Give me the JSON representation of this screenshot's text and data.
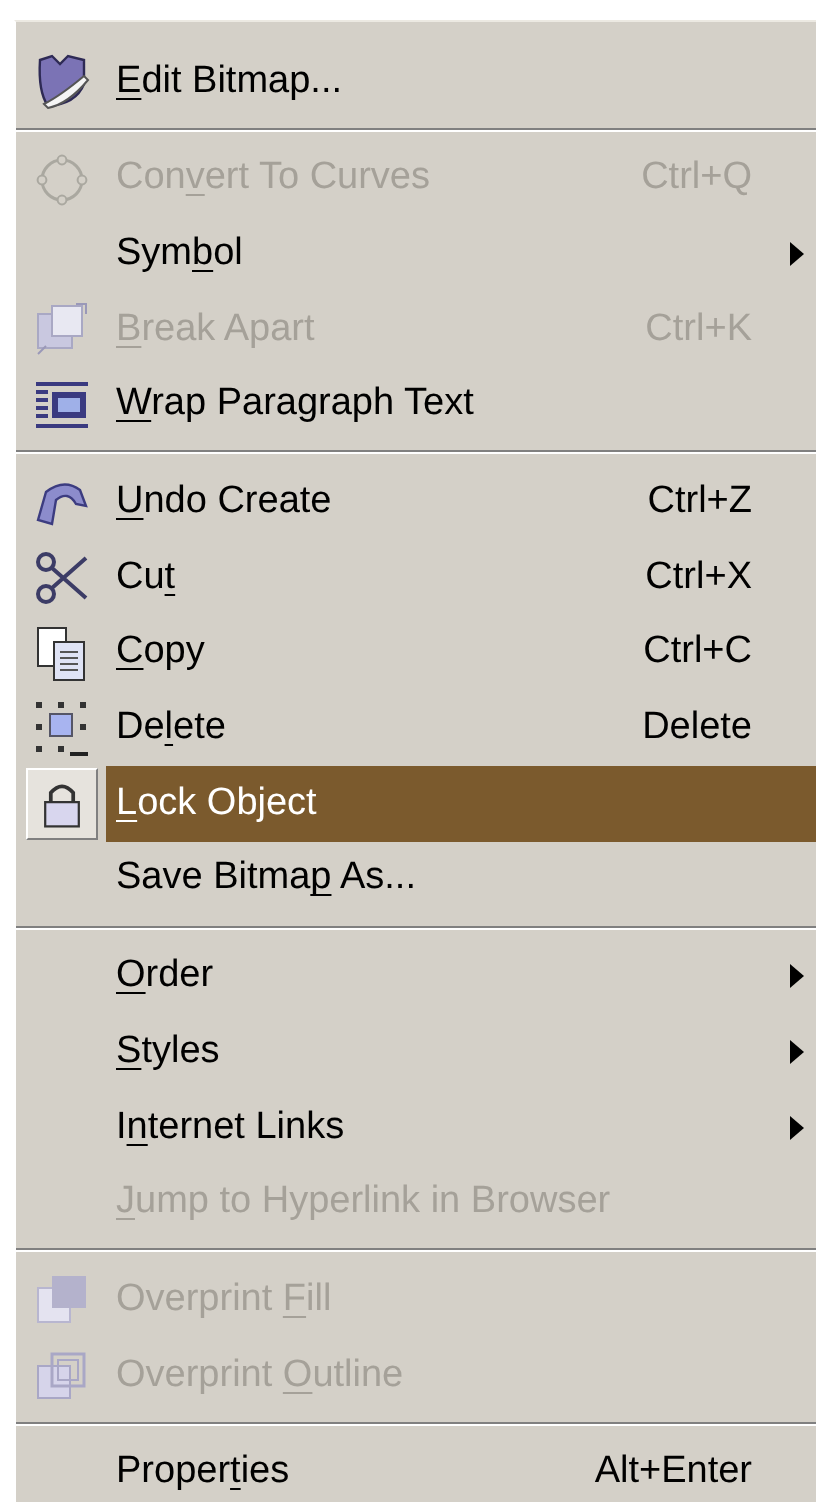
{
  "menu": {
    "sections": [
      {
        "items": [
          {
            "label": {
              "key": "E",
              "after": "dit Bitmap..."
            },
            "disabled": false,
            "selected": false,
            "submenu": false
          }
        ]
      },
      {
        "items": [
          {
            "label": {
              "before": "Con",
              "key": "v",
              "after": "ert To Curves"
            },
            "shortcut": "Ctrl+Q",
            "disabled": true,
            "selected": false,
            "submenu": false
          },
          {
            "label": {
              "before": "Sym",
              "key": "b",
              "after": "ol"
            },
            "disabled": false,
            "selected": false,
            "submenu": true
          },
          {
            "label": {
              "key": "B",
              "after": "reak Apart"
            },
            "shortcut": "Ctrl+K",
            "disabled": true,
            "selected": false,
            "submenu": false
          },
          {
            "label": {
              "key": "W",
              "after": "rap Paragraph Text"
            },
            "disabled": false,
            "selected": false,
            "submenu": false
          }
        ]
      },
      {
        "items": [
          {
            "label": {
              "key": "U",
              "after": "ndo Create"
            },
            "shortcut": "Ctrl+Z",
            "disabled": false,
            "selected": false,
            "submenu": false
          },
          {
            "label": {
              "before": "Cu",
              "key": "t"
            },
            "shortcut": "Ctrl+X",
            "disabled": false,
            "selected": false,
            "submenu": false
          },
          {
            "label": {
              "key": "C",
              "after": "opy"
            },
            "shortcut": "Ctrl+C",
            "disabled": false,
            "selected": false,
            "submenu": false
          },
          {
            "label": {
              "before": "De",
              "key": "l",
              "after": "ete"
            },
            "shortcut": "Delete",
            "disabled": false,
            "selected": false,
            "submenu": false
          },
          {
            "label": {
              "key": "L",
              "after": "ock Object"
            },
            "disabled": false,
            "selected": true,
            "submenu": false
          },
          {
            "label": {
              "before": "Save Bitma",
              "key": "p",
              "after": " As..."
            },
            "disabled": false,
            "selected": false,
            "submenu": false
          }
        ]
      },
      {
        "items": [
          {
            "label": {
              "key": "O",
              "after": "rder"
            },
            "disabled": false,
            "selected": false,
            "submenu": true
          },
          {
            "label": {
              "key": "S",
              "after": "tyles"
            },
            "disabled": false,
            "selected": false,
            "submenu": true
          },
          {
            "label": {
              "before": "I",
              "key": "n",
              "after": "ternet Links"
            },
            "disabled": false,
            "selected": false,
            "submenu": true
          },
          {
            "label": {
              "key": "J",
              "after": "ump to Hyperlink in Browser"
            },
            "disabled": true,
            "selected": false,
            "submenu": false
          }
        ]
      },
      {
        "items": [
          {
            "label": {
              "before": "Overprint ",
              "key": "F",
              "after": "ill"
            },
            "disabled": true,
            "selected": false,
            "submenu": false
          },
          {
            "label": {
              "before": "Overprint ",
              "key": "O",
              "after": "utline"
            },
            "disabled": true,
            "selected": false,
            "submenu": false
          }
        ]
      },
      {
        "items": [
          {
            "label": {
              "before": "Proper",
              "key": "t",
              "after": "ies"
            },
            "shortcut": "Alt+Enter",
            "disabled": false,
            "selected": false,
            "submenu": false
          }
        ]
      }
    ]
  }
}
